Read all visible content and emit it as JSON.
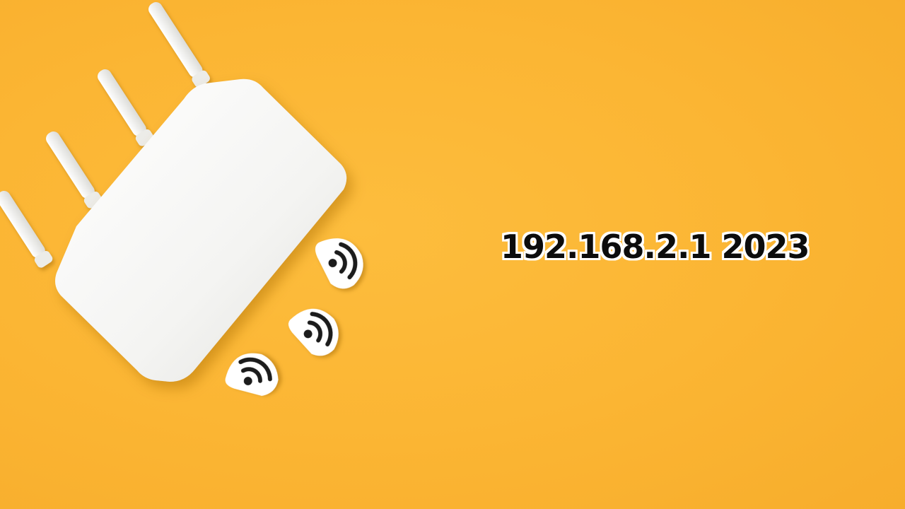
{
  "headline": "192.168.2.1 2023",
  "colors": {
    "background": "#fbb635",
    "router": "#f7f7f5",
    "text": "#0c0c0c",
    "text_outline": "#ffffff"
  },
  "icons": [
    "router-image",
    "wifi-sticker-icon",
    "wifi-sticker-icon",
    "wifi-sticker-icon"
  ]
}
